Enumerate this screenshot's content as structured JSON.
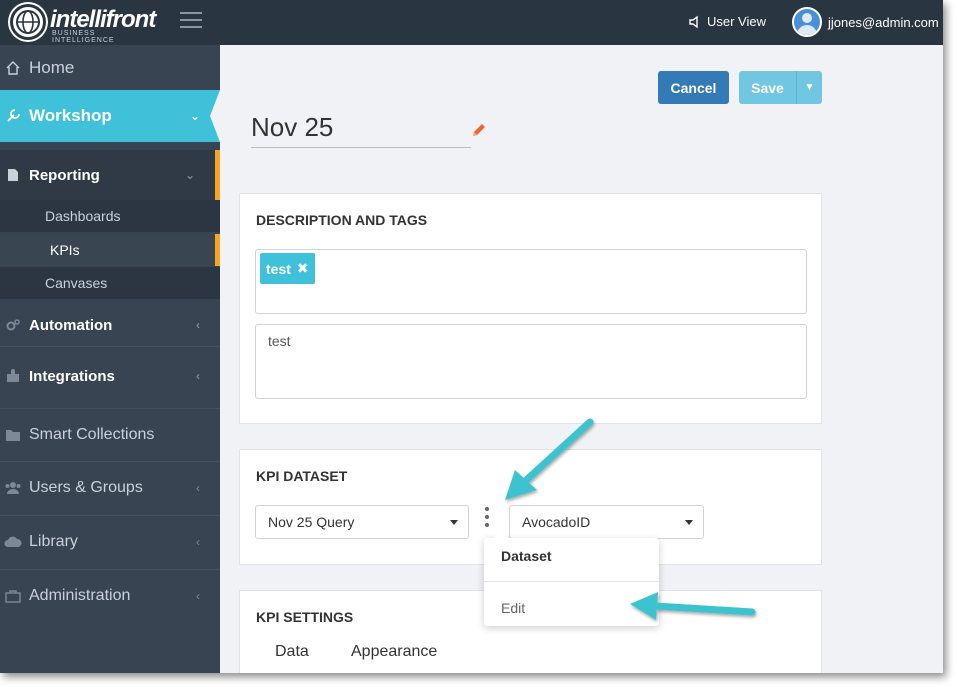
{
  "topbar": {
    "logo_text": "intellifront",
    "logo_sub": "BUSINESS INTELLIGENCE",
    "user_view_label": "User View",
    "user_email": "jjones@admin.com"
  },
  "sidebar": {
    "home": "Home",
    "workshop": "Workshop",
    "reporting": "Reporting",
    "reporting_items": [
      "Dashboards",
      "KPIs",
      "Canvases"
    ],
    "automation": "Automation",
    "integrations": "Integrations",
    "smart_collections": "Smart Collections",
    "users_groups": "Users & Groups",
    "library": "Library",
    "administration": "Administration"
  },
  "toolbar": {
    "cancel_label": "Cancel",
    "save_label": "Save"
  },
  "kpi": {
    "title": "Nov 25"
  },
  "description_panel": {
    "heading": "DESCRIPTION AND TAGS",
    "tags": [
      "test"
    ],
    "description": "test"
  },
  "dataset_panel": {
    "heading": "KPI DATASET",
    "dataset_value": "Nov 25 Query",
    "field_value": "AvocadoID"
  },
  "dataset_menu": {
    "header": "Dataset",
    "edit_label": "Edit"
  },
  "settings_panel": {
    "heading": "KPI SETTINGS",
    "tabs": [
      "Data",
      "Appearance"
    ]
  },
  "colors": {
    "topbar": "#2a3542",
    "sidebar": "#384452",
    "accent": "#3fc1d9",
    "active_marker": "#f5a623",
    "cancel": "#337ab7",
    "arrow": "#3cc3cf"
  }
}
